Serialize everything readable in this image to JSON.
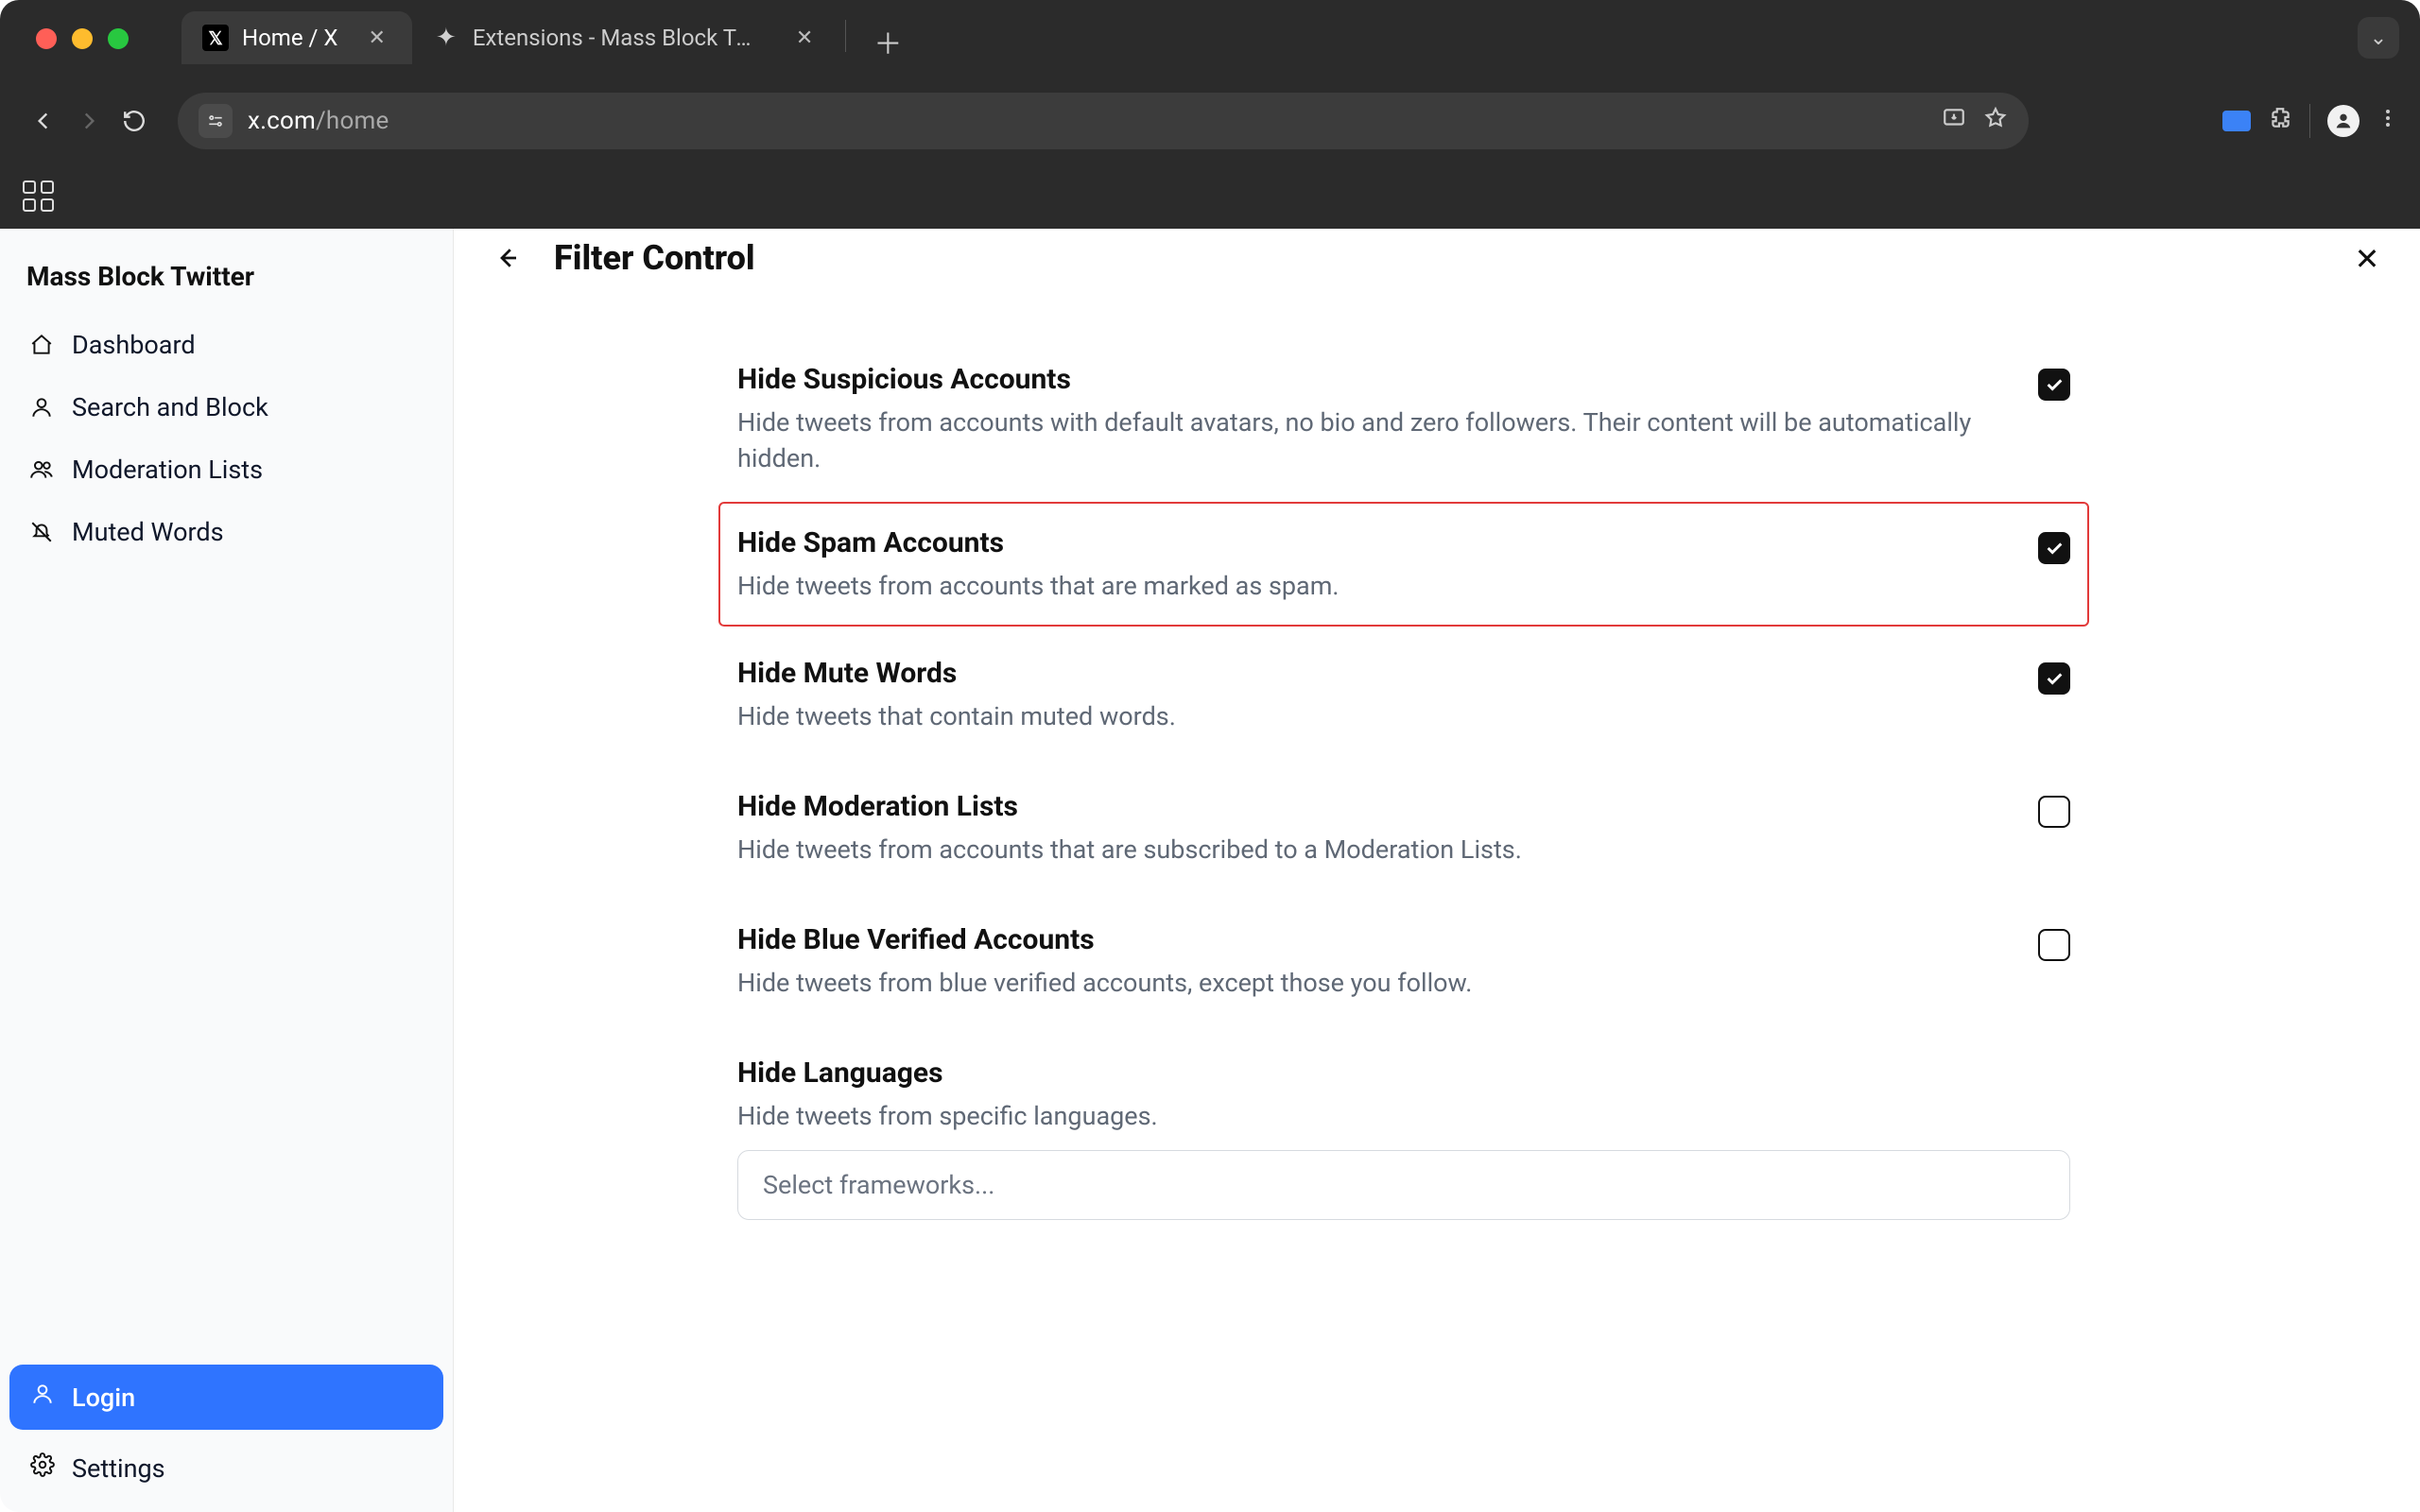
{
  "browser": {
    "tabs": [
      {
        "title": "Home / X",
        "active": true
      },
      {
        "title": "Extensions - Mass Block Twit…",
        "active": false
      }
    ],
    "url_host": "x.com",
    "url_path": "/home"
  },
  "sidebar": {
    "title": "Mass Block Twitter",
    "items": [
      {
        "label": "Dashboard"
      },
      {
        "label": "Search and Block"
      },
      {
        "label": "Moderation Lists"
      },
      {
        "label": "Muted Words"
      }
    ],
    "login_label": "Login",
    "settings_label": "Settings"
  },
  "page": {
    "heading": "Filter Control"
  },
  "filters": [
    {
      "title": "Hide Suspicious Accounts",
      "desc": "Hide tweets from accounts with default avatars, no bio and zero followers. Their content will be automatically hidden.",
      "checked": true,
      "highlight": false
    },
    {
      "title": "Hide Spam Accounts",
      "desc": "Hide tweets from accounts that are marked as spam.",
      "checked": true,
      "highlight": true
    },
    {
      "title": "Hide Mute Words",
      "desc": "Hide tweets that contain muted words.",
      "checked": true,
      "highlight": false
    },
    {
      "title": "Hide Moderation Lists",
      "desc": "Hide tweets from accounts that are subscribed to a Moderation Lists.",
      "checked": false,
      "highlight": false
    },
    {
      "title": "Hide Blue Verified Accounts",
      "desc": "Hide tweets from blue verified accounts, except those you follow.",
      "checked": false,
      "highlight": false
    }
  ],
  "languages_section": {
    "title": "Hide Languages",
    "desc": "Hide tweets from specific languages.",
    "select_placeholder": "Select frameworks..."
  }
}
